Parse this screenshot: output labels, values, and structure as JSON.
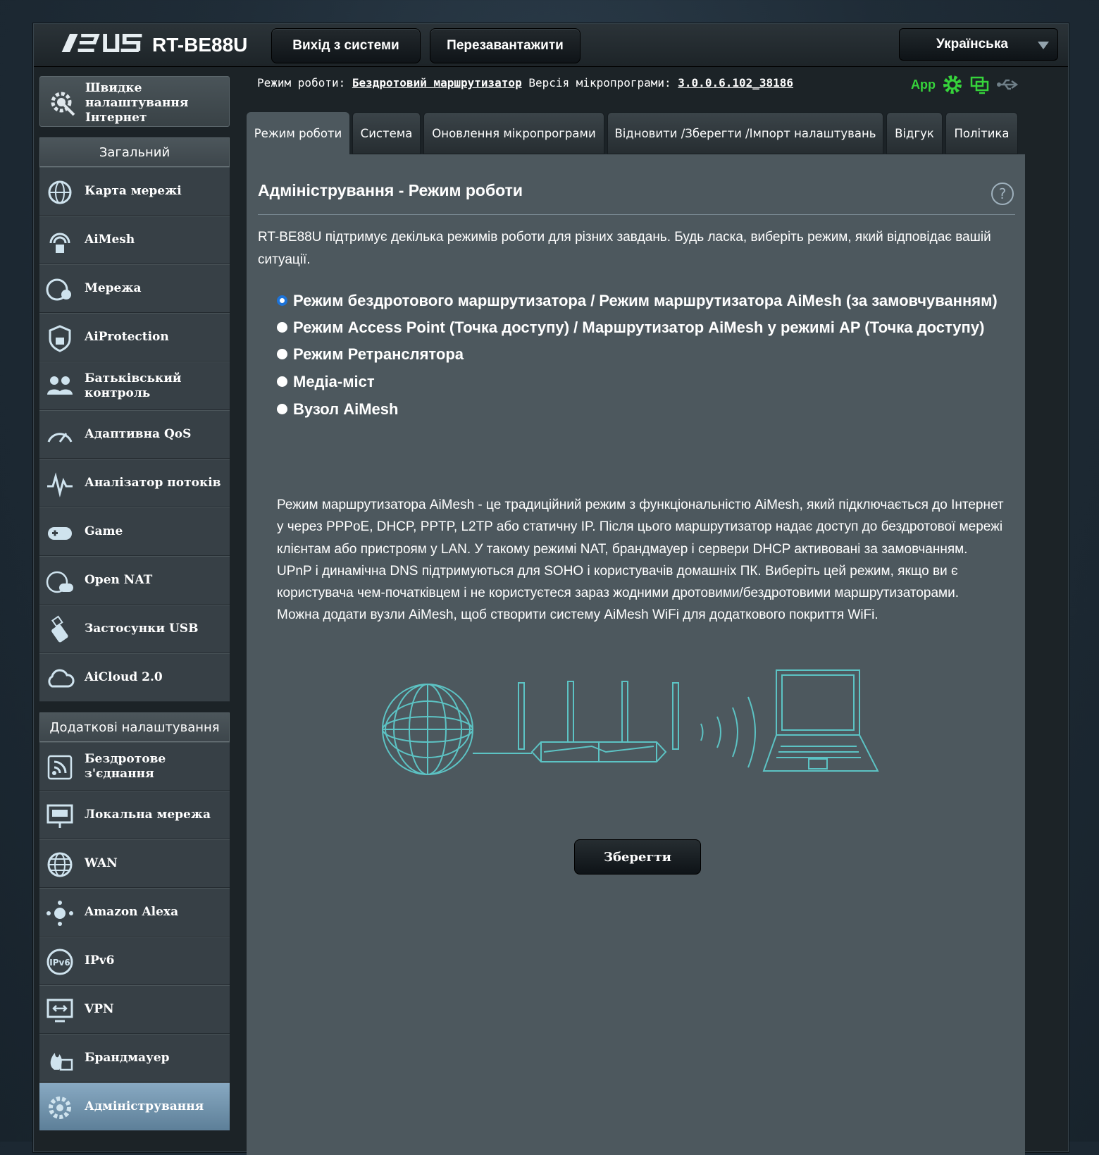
{
  "header": {
    "logo": "/ISUS",
    "model": "RT-BE88U",
    "logout_label": "Вихід з системи",
    "reboot_label": "Перезавантажити",
    "language": "Українська"
  },
  "status": {
    "mode_label": "Режим роботи:",
    "mode_value": "Бездротовий маршрутизатор",
    "fw_label": "Версія мікропрограми:",
    "fw_value": "3.0.0.6.102_38186",
    "app_label": "App"
  },
  "sidebar": {
    "quick_setup": "Швидке налаштування Інтернет",
    "general_title": "Загальний",
    "general_items": [
      {
        "label": "Карта мережі",
        "icon": "network-map-icon"
      },
      {
        "label": "AiMesh",
        "icon": "aimesh-icon"
      },
      {
        "label": "Мережа",
        "icon": "guest-network-icon"
      },
      {
        "label": "AiProtection",
        "icon": "shield-lock-icon"
      },
      {
        "label": "Батьківський контроль",
        "icon": "parental-control-icon"
      },
      {
        "label": "Адаптивна QoS",
        "icon": "speedometer-icon"
      },
      {
        "label": "Аналізатор потоків",
        "icon": "traffic-analyzer-icon"
      },
      {
        "label": "Game",
        "icon": "gamepad-icon"
      },
      {
        "label": "Open NAT",
        "icon": "open-nat-icon"
      },
      {
        "label": "Застосунки USB",
        "icon": "usb-icon"
      },
      {
        "label": "AiCloud 2.0",
        "icon": "cloud-icon"
      }
    ],
    "advanced_title": "Додаткові налаштування",
    "advanced_items": [
      {
        "label": "Бездротове з'єднання",
        "icon": "wireless-icon"
      },
      {
        "label": "Локальна мережа",
        "icon": "lan-icon"
      },
      {
        "label": "WAN",
        "icon": "globe-icon"
      },
      {
        "label": "Amazon Alexa",
        "icon": "alexa-icon"
      },
      {
        "label": "IPv6",
        "icon": "ipv6-icon"
      },
      {
        "label": "VPN",
        "icon": "vpn-icon"
      },
      {
        "label": "Брандмауер",
        "icon": "firewall-icon"
      },
      {
        "label": "Адміністрування",
        "icon": "gear-icon"
      }
    ]
  },
  "tabs": [
    {
      "label": "Режим роботи"
    },
    {
      "label": "Система"
    },
    {
      "label": "Оновлення мікропрограми"
    },
    {
      "label": "Відновити /Зберегти /Імпорт налаштувань"
    },
    {
      "label": "Відгук"
    },
    {
      "label": "Політика"
    }
  ],
  "content": {
    "title": "Адміністрування - Режим роботи",
    "help": "?",
    "description": "RT-BE88U підтримує декілька режимів роботи для різних завдань. Будь ласка, виберіть режим, який відповідає вашій ситуації.",
    "options": [
      {
        "label": "Режим бездротового маршрутизатора / Режим маршрутизатора AiMesh (за замовчуванням)",
        "checked": true
      },
      {
        "label": "Режим Access Point (Точка доступу) / Маршрутизатор AiMesh у режимі AP (Точка доступу)",
        "checked": false
      },
      {
        "label": "Режим Ретранслятора",
        "checked": false
      },
      {
        "label": "Медіа-міст",
        "checked": false
      },
      {
        "label": "Вузол AiMesh",
        "checked": false
      }
    ],
    "mode_description": "Режим маршрутизатора AiMesh - це традиційний режим з функціональністю AiMesh, який підключається до Інтернет у через PPPoE, DHCP, PPTP, L2TP або статичну IP. Після цього маршрутизатор надає доступ до бездротової мережі клієнтам або пристроям у LAN. У такому режимі NAT, брандмауер і сервери DHCP активовані за замовчанням. UPnP і динамічна DNS підтримуються для SOHO і користувачів домашніх ПК. Виберіть цей режим, якщо ви є користувача чем-початківцем і не користуєтеся зараз жодними дротовими/бездротовими маршрутизаторами.",
    "mode_description_2": "Можна додати вузли AiMesh, щоб створити систему AiMesh WiFi для додаткового покриття WiFi.",
    "save_label": "Зберегти"
  },
  "colors": {
    "accent_green": "#36d33b",
    "radio_blue": "#1d73d8",
    "illustration": "#5fd6d6"
  }
}
